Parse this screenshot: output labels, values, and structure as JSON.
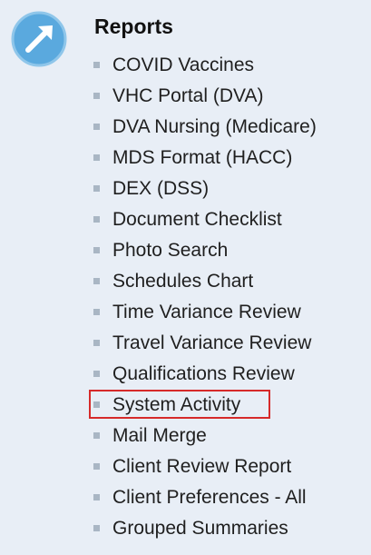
{
  "section": {
    "icon": "arrow-up-right-circle-icon",
    "accent_color": "#5aa9de",
    "title": "Reports"
  },
  "reports": [
    {
      "label": "COVID Vaccines"
    },
    {
      "label": "VHC Portal (DVA)"
    },
    {
      "label": "DVA Nursing (Medicare)"
    },
    {
      "label": "MDS Format (HACC)"
    },
    {
      "label": "DEX (DSS)"
    },
    {
      "label": "Document Checklist"
    },
    {
      "label": "Photo Search"
    },
    {
      "label": "Schedules Chart"
    },
    {
      "label": "Time Variance Review"
    },
    {
      "label": "Travel Variance Review"
    },
    {
      "label": "Qualifications Review"
    },
    {
      "label": "System Activity",
      "highlighted": true
    },
    {
      "label": "Mail Merge"
    },
    {
      "label": "Client Review Report"
    },
    {
      "label": "Client Preferences - All"
    },
    {
      "label": "Grouped Summaries"
    }
  ],
  "highlight_color": "#d62a2a"
}
